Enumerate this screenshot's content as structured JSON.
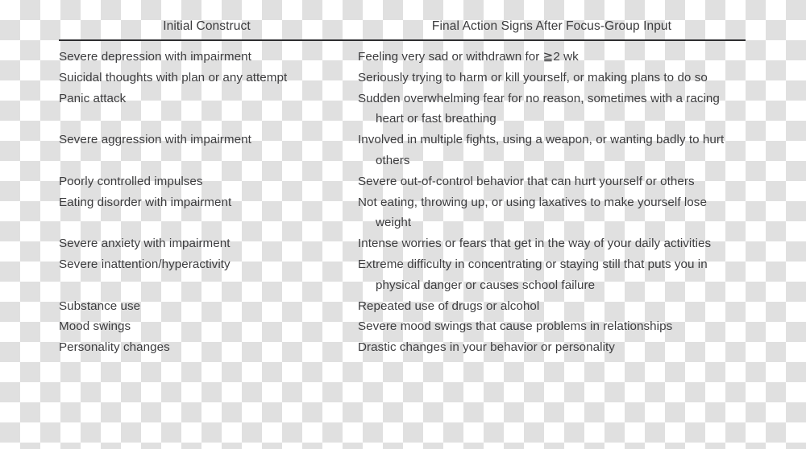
{
  "table": {
    "headers": {
      "col1": "Initial Construct",
      "col2": "Final Action Signs After Focus-Group Input"
    },
    "rows": [
      {
        "construct": "Severe depression with impairment",
        "action_sign": "Feeling very sad or withdrawn for ≧2 wk"
      },
      {
        "construct": "Suicidal thoughts with plan or any attempt",
        "action_sign": "Seriously trying to harm or kill yourself, or making plans to do so"
      },
      {
        "construct": "Panic attack",
        "action_sign": "Sudden overwhelming fear for no reason, sometimes with a racing heart or fast breathing"
      },
      {
        "construct": "Severe aggression with impairment",
        "action_sign": "Involved in multiple fights, using a weapon, or wanting badly to hurt others"
      },
      {
        "construct": "Poorly controlled impulses",
        "action_sign": "Severe out-of-control behavior that can hurt yourself or others"
      },
      {
        "construct": "Eating disorder with impairment",
        "action_sign": "Not eating, throwing up, or using laxatives to make yourself lose weight"
      },
      {
        "construct": "Severe anxiety with impairment",
        "action_sign": "Intense worries or fears that get in the way of your daily activities"
      },
      {
        "construct": "Severe inattention/hyperactivity",
        "action_sign": "Extreme difficulty in concentrating or staying still that puts you in physical danger or causes school failure"
      },
      {
        "construct": "Substance use",
        "action_sign": "Repeated use of drugs or alcohol"
      },
      {
        "construct": "Mood swings",
        "action_sign": "Severe mood swings that cause problems in relationships"
      },
      {
        "construct": "Personality changes",
        "action_sign": "Drastic changes in your behavior or personality"
      }
    ]
  },
  "colors": {
    "text": "#3c3c3e",
    "header_text": "#3a3a3c",
    "rule": "#2e2e30",
    "checker_light": "#ffffff",
    "checker_dark": "#e0e0e0"
  }
}
